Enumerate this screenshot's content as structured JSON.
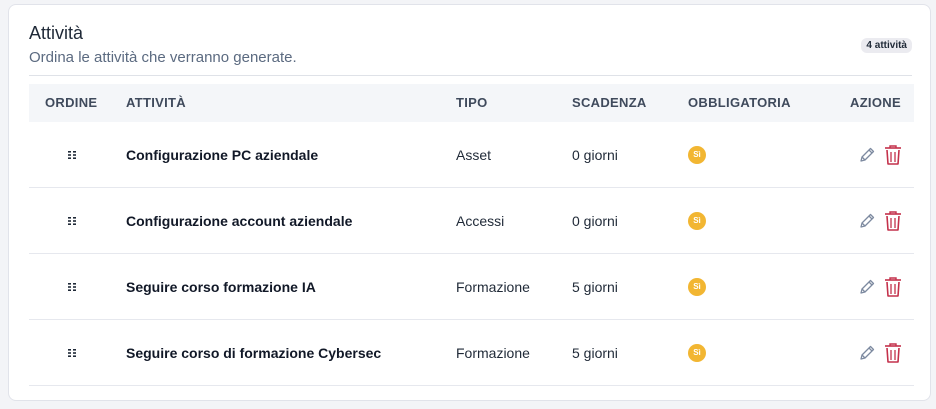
{
  "header": {
    "title": "Attività",
    "subtitle": "Ordina le attività che verranno generate.",
    "count_badge": "4 attività"
  },
  "table": {
    "columns": {
      "order": "ORDINE",
      "activity": "ATTIVITÀ",
      "type": "TIPO",
      "deadline": "SCADENZA",
      "required": "OBBLIGATORIA",
      "action": "AZIONE"
    },
    "rows": [
      {
        "name": "Configurazione PC aziendale",
        "type": "Asset",
        "deadline": "0 giorni",
        "required": "Sì"
      },
      {
        "name": "Configurazione account aziendale",
        "type": "Accessi",
        "deadline": "0 giorni",
        "required": "Sì"
      },
      {
        "name": "Seguire corso formazione IA",
        "type": "Formazione",
        "deadline": "5 giorni",
        "required": "Sì"
      },
      {
        "name": "Seguire corso di formazione Cybersec",
        "type": "Formazione",
        "deadline": "5 giorni",
        "required": "Sì"
      }
    ]
  },
  "icons": {
    "drag": "drag-handle-icon",
    "edit": "pencil-icon",
    "delete": "trash-icon"
  },
  "colors": {
    "required_badge": "#f2b632",
    "edit_icon": "#7d8aa0",
    "delete_icon": "#c4314b"
  }
}
